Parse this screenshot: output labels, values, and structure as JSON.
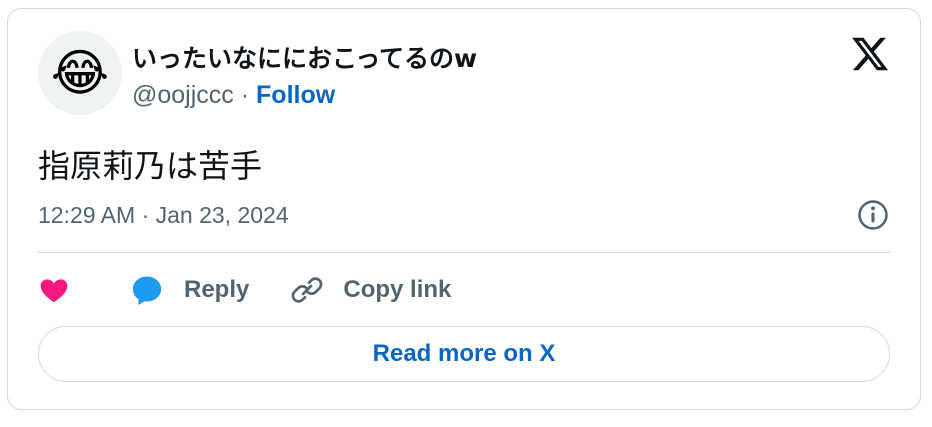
{
  "author": {
    "avatar_emoji": "😂",
    "display_name": "いったいなににおこってるのw",
    "handle": "@oojjccc",
    "separator": "·",
    "follow_label": "Follow"
  },
  "tweet": {
    "text": "指原莉乃は苦手",
    "timestamp": "12:29 AM · Jan 23, 2024"
  },
  "actions": {
    "reply_label": "Reply",
    "copy_link_label": "Copy link"
  },
  "read_more_label": "Read more on X",
  "colors": {
    "heart": "#f91880",
    "reply_bubble": "#1d9bf0",
    "link_blue": "#0a66c2",
    "secondary_text": "#536471",
    "border": "#cfd9de"
  }
}
